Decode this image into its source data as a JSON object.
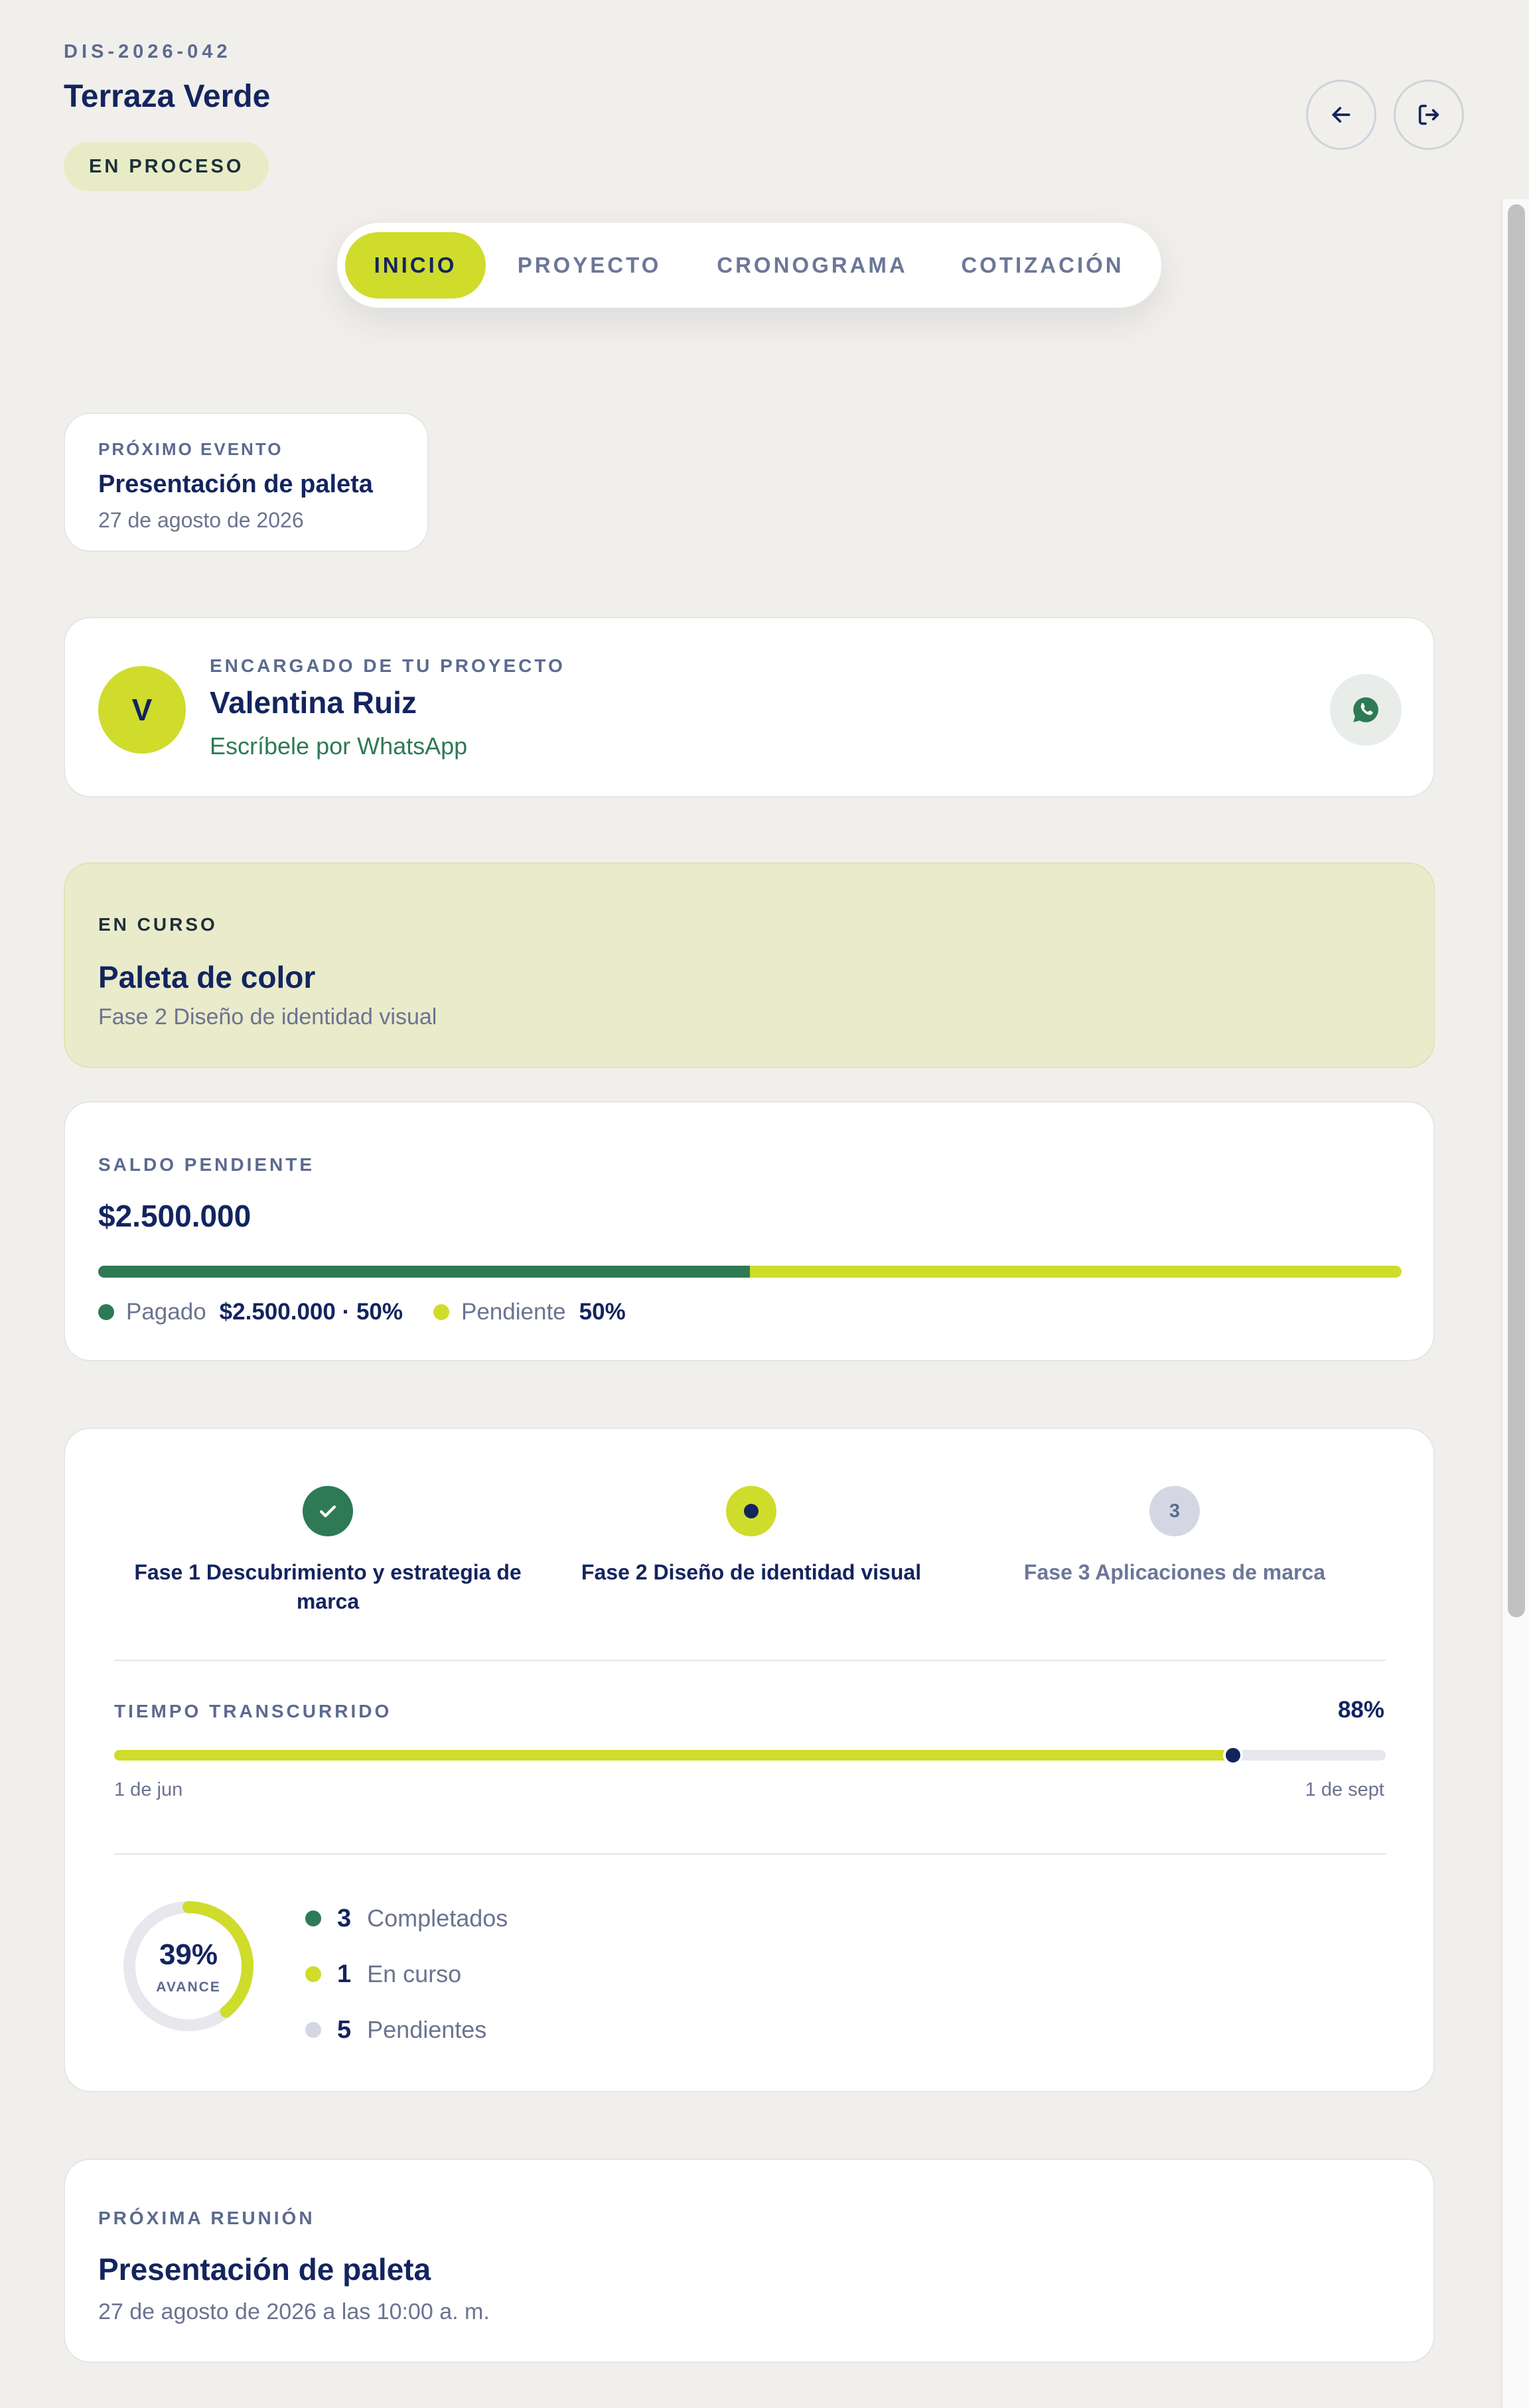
{
  "project": {
    "code": "DIS-2026-042",
    "name": "Terraza Verde",
    "status": "EN PROCESO"
  },
  "tabs": [
    {
      "label": "INICIO",
      "active": true
    },
    {
      "label": "PROYECTO",
      "active": false
    },
    {
      "label": "CRONOGRAMA",
      "active": false
    },
    {
      "label": "COTIZACIÓN",
      "active": false
    }
  ],
  "next_event": {
    "label": "PRÓXIMO EVENTO",
    "title": "Presentación de paleta",
    "date": "27 de agosto de 2026"
  },
  "manager": {
    "label": "ENCARGADO DE TU PROYECTO",
    "initial": "V",
    "name": "Valentina Ruiz",
    "contact": "Escríbele por WhatsApp"
  },
  "current": {
    "label": "EN CURSO",
    "title": "Paleta de color",
    "phase": "Fase 2 Diseño de identidad visual"
  },
  "balance": {
    "label": "SALDO PENDIENTE",
    "amount": "$2.500.000",
    "paid_fraction": 0.5,
    "paid_label": "Pagado",
    "paid_value": "$2.500.000 · 50%",
    "pending_label": "Pendiente",
    "pending_value": "50%"
  },
  "phases": [
    {
      "label": "Fase 1 Descubrimiento y estrategia de marca",
      "state": "done",
      "marker": ""
    },
    {
      "label": "Fase 2 Diseño de identidad visual",
      "state": "current",
      "marker": ""
    },
    {
      "label": "Fase 3 Aplicaciones de marca",
      "state": "pending",
      "marker": "3"
    }
  ],
  "time": {
    "label": "TIEMPO TRANSCURRIDO",
    "percent_text": "88%",
    "fraction": 0.88,
    "start": "1 de jun",
    "end": "1 de sept"
  },
  "progress": {
    "percent_text": "39%",
    "fraction": 0.39,
    "caption": "AVANCE",
    "stats": [
      {
        "count": "3",
        "label": "Completados",
        "color": "#2e7a55"
      },
      {
        "count": "1",
        "label": "En curso",
        "color": "#cfdc2c"
      },
      {
        "count": "5",
        "label": "Pendientes",
        "color": "#d4d7e3"
      }
    ]
  },
  "meeting": {
    "label": "PRÓXIMA REUNIÓN",
    "title": "Presentación de paleta",
    "datetime": "27 de agosto de 2026 a las 10:00 a. m."
  },
  "colors": {
    "accent": "#cfdc2c",
    "navy": "#13245f",
    "green": "#2e7a55",
    "background": "#f1efeb"
  },
  "icons": {
    "back": "arrow-left-icon",
    "logout": "logout-icon",
    "whatsapp": "whatsapp-icon",
    "check": "check-icon"
  }
}
